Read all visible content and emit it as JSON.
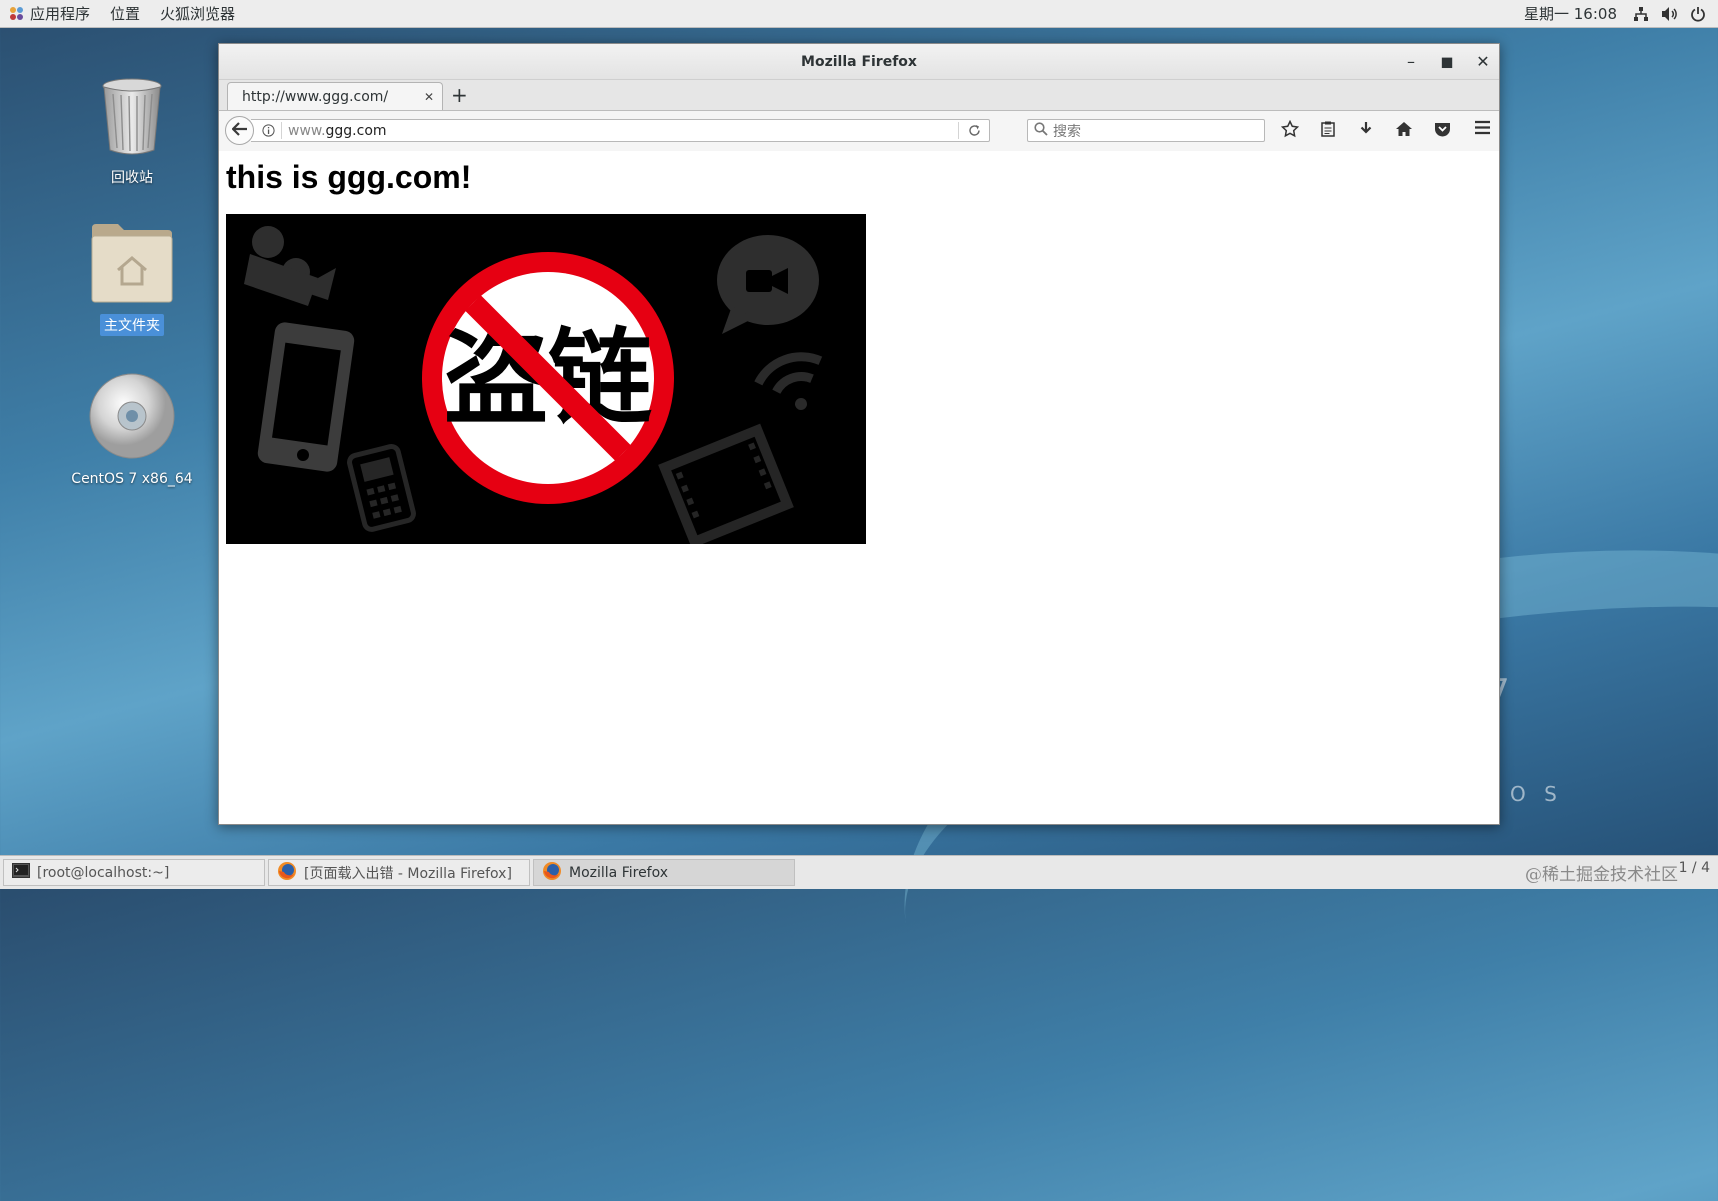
{
  "topbar": {
    "menus": [
      "应用程序",
      "位置",
      "火狐浏览器"
    ],
    "clock": "星期一 16:08",
    "tray_icons": [
      "network-icon",
      "volume-icon",
      "power-icon"
    ]
  },
  "desktop": {
    "icons": [
      {
        "label": "回收站",
        "icon": "trash-icon"
      },
      {
        "label": "主文件夹",
        "icon": "home-folder-icon",
        "selected": true
      },
      {
        "label": "CentOS 7 x86_64",
        "icon": "disc-icon"
      }
    ],
    "wallpaper_text": [
      "7",
      "O S"
    ]
  },
  "window": {
    "title": "Mozilla Firefox",
    "tab": {
      "title": "http://www.ggg.com/"
    },
    "url": {
      "prefix": "www.",
      "domain": "ggg.com"
    },
    "search_placeholder": "搜索",
    "toolbar_icons": [
      "bookmark-star-icon",
      "reading-list-icon",
      "download-icon",
      "home-icon",
      "pocket-icon",
      "menu-icon"
    ]
  },
  "page": {
    "heading": "this is ggg.com!",
    "image_text": "盗链"
  },
  "taskbar": {
    "tasks": [
      {
        "label": "[root@localhost:~]",
        "icon": "terminal-icon",
        "active": false
      },
      {
        "label": "[页面载入出错 - Mozilla Firefox]",
        "icon": "firefox-icon",
        "active": false
      },
      {
        "label": "Mozilla Firefox",
        "icon": "firefox-icon",
        "active": true
      }
    ],
    "workspace": "1 / 4"
  },
  "watermark": "@稀土掘金技术社区",
  "colors": {
    "selection": "#4a90d9",
    "prohibit_red": "#e60012"
  }
}
